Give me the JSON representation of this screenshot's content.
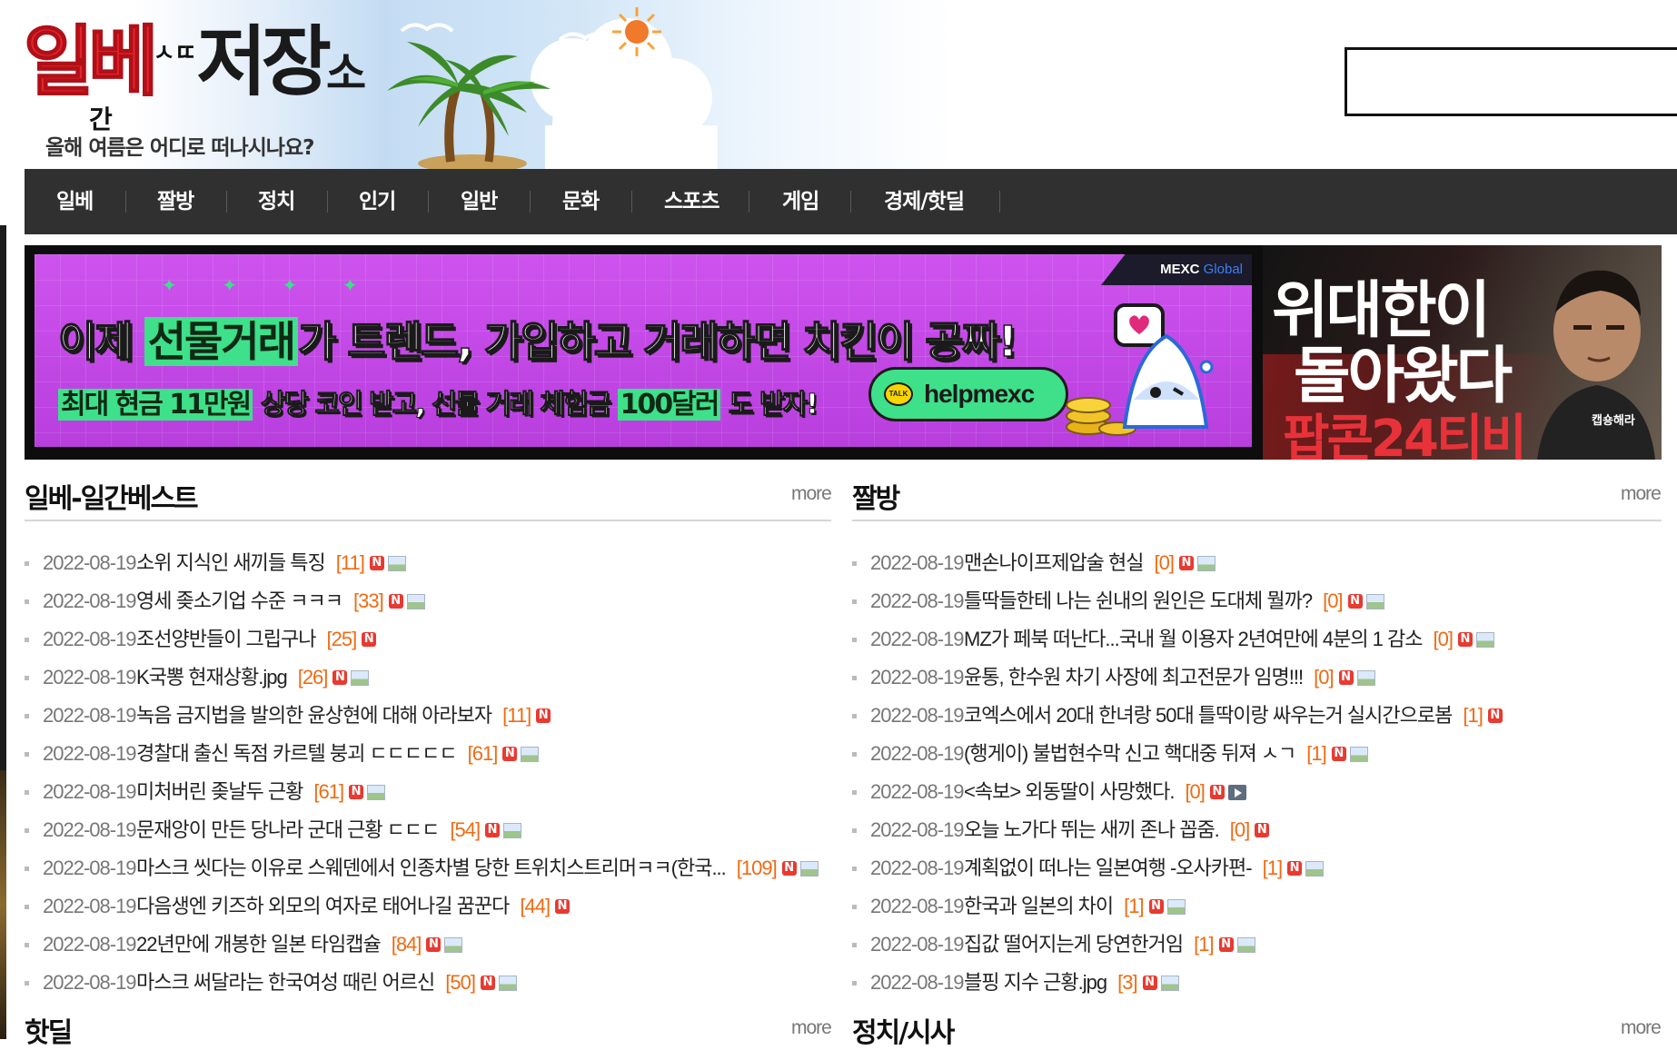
{
  "header": {
    "logo": {
      "main_red": "일베",
      "small_letters": "ㅅㄸ",
      "sub_char": "간",
      "main_black": "저장",
      "small_so": "소"
    },
    "tagline": "올해 여름은 어디로 떠나시나요?"
  },
  "nav": {
    "items": [
      "일베",
      "짤방",
      "정치",
      "인기",
      "일반",
      "문화",
      "스포츠",
      "게임",
      "경제/핫딜"
    ]
  },
  "ads": {
    "ad1": {
      "brand": "MEXC",
      "brand_suffix": "Global",
      "sparkles": "✦ ✦ ✦ ✦",
      "line1_pre": "이제 ",
      "line1_hl": "선물거래",
      "line1_post": "가 트렌드, 가입하고 거래하면 치킨이 공짜!",
      "line2_hl1": "최대 현금 11만원",
      "line2_mid": " 상당 코인 받고, 선물 거래 체험금 ",
      "line2_hl2": "100달러",
      "line2_post": " 도 받자!",
      "pill_icon": "TALK",
      "pill_text": "helpmexc"
    },
    "ad2": {
      "line1": "위대한이",
      "line2": "돌아왔다",
      "line3": "팝콘24티비",
      "tag": "캡숑해라"
    }
  },
  "boards": {
    "daily_best": {
      "title": "일베-일간베스트",
      "more": "more",
      "posts": [
        {
          "date": "2022-08-19",
          "title": "소위 지식인 새끼들 특징",
          "count": "[11]",
          "new": "N",
          "img": true,
          "vid": false
        },
        {
          "date": "2022-08-19",
          "title": "영세 좆소기업 수준 ㅋㅋㅋ",
          "count": "[33]",
          "new": "N",
          "img": true,
          "vid": false
        },
        {
          "date": "2022-08-19",
          "title": "조선양반들이 그립구나",
          "count": "[25]",
          "new": "N",
          "img": false,
          "vid": false
        },
        {
          "date": "2022-08-19",
          "title": "K국뽕 현재상황.jpg",
          "count": "[26]",
          "new": "N",
          "img": true,
          "vid": false
        },
        {
          "date": "2022-08-19",
          "title": "녹음 금지법을 발의한 윤상현에 대해 아라보자",
          "count": "[11]",
          "new": "N",
          "img": false,
          "vid": false
        },
        {
          "date": "2022-08-19",
          "title": "경찰대 출신 독점 카르텔 붕괴 ㄷㄷㄷㄷㄷ",
          "count": "[61]",
          "new": "N",
          "img": true,
          "vid": false
        },
        {
          "date": "2022-08-19",
          "title": "미처버린 좆날두 근황",
          "count": "[61]",
          "new": "N",
          "img": true,
          "vid": false
        },
        {
          "date": "2022-08-19",
          "title": "문재앙이 만든 당나라 군대 근황 ㄷㄷㄷ",
          "count": "[54]",
          "new": "N",
          "img": true,
          "vid": false
        },
        {
          "date": "2022-08-19",
          "title": "마스크 씻다는 이유로 스웨덴에서 인종차별 당한 트위치스트리머ㅋㅋ(한국...",
          "count": "[109]",
          "new": "N",
          "img": true,
          "vid": false
        },
        {
          "date": "2022-08-19",
          "title": "다음생엔 키즈하 외모의 여자로 태어나길 꿈꾼다",
          "count": "[44]",
          "new": "N",
          "img": false,
          "vid": false
        },
        {
          "date": "2022-08-19",
          "title": "22년만에 개봉한 일본 타임캡슐",
          "count": "[84]",
          "new": "N",
          "img": true,
          "vid": false
        },
        {
          "date": "2022-08-19",
          "title": "마스크 써달라는 한국여성 때린 어르신",
          "count": "[50]",
          "new": "N",
          "img": true,
          "vid": false
        }
      ]
    },
    "jjalbang": {
      "title": "짤방",
      "more": "more",
      "posts": [
        {
          "date": "2022-08-19",
          "title": "맨손나이프제압술 현실",
          "count": "[0]",
          "new": "N",
          "img": true,
          "vid": false
        },
        {
          "date": "2022-08-19",
          "title": "틀딱들한테 나는 쉰내의 원인은 도대체 뭘까?",
          "count": "[0]",
          "new": "N",
          "img": true,
          "vid": false
        },
        {
          "date": "2022-08-19",
          "title": "MZ가 페북 떠난다...국내 월 이용자 2년여만에 4분의 1 감소",
          "count": "[0]",
          "new": "N",
          "img": true,
          "vid": false
        },
        {
          "date": "2022-08-19",
          "title": "윤통, 한수원 차기 사장에 최고전문가 임명!!!",
          "count": "[0]",
          "new": "N",
          "img": true,
          "vid": false
        },
        {
          "date": "2022-08-19",
          "title": "코엑스에서 20대 한녀랑 50대 틀딱이랑 싸우는거 실시간으로봄",
          "count": "[1]",
          "new": "N",
          "img": false,
          "vid": false
        },
        {
          "date": "2022-08-19",
          "title": "(행게이) 불법현수막 신고 핵대중 뒤져 ㅅㄱ",
          "count": "[1]",
          "new": "N",
          "img": true,
          "vid": false
        },
        {
          "date": "2022-08-19",
          "title": "<속보> 외동딸이 사망했다.",
          "count": "[0]",
          "new": "N",
          "img": false,
          "vid": true
        },
        {
          "date": "2022-08-19",
          "title": "오늘 노가다 뛰는 새끼 존나 꼽줌.",
          "count": "[0]",
          "new": "N",
          "img": false,
          "vid": false
        },
        {
          "date": "2022-08-19",
          "title": "계획없이 떠나는 일본여행 -오사카편-",
          "count": "[1]",
          "new": "N",
          "img": true,
          "vid": false
        },
        {
          "date": "2022-08-19",
          "title": "한국과 일본의 차이",
          "count": "[1]",
          "new": "N",
          "img": true,
          "vid": false
        },
        {
          "date": "2022-08-19",
          "title": "집값 떨어지는게 당연한거임",
          "count": "[1]",
          "new": "N",
          "img": true,
          "vid": false
        },
        {
          "date": "2022-08-19",
          "title": "블핑 지수 근황.jpg",
          "count": "[3]",
          "new": "N",
          "img": true,
          "vid": false
        }
      ]
    },
    "hotdeal": {
      "title": "핫딜",
      "more": "more"
    },
    "politics": {
      "title": "정치/시사",
      "more": "more"
    }
  },
  "colors": {
    "nav_bg": "#303030",
    "count_orange": "#ef6b13",
    "new_badge_red": "#e73a30",
    "logo_red": "#e8232b",
    "ad_purple": "#c24ae6",
    "ad_green": "#3ee08a"
  },
  "icons": [
    "new-badge-icon",
    "image-attachment-icon",
    "video-attachment-icon",
    "palm-tree-icon",
    "sun-icon",
    "seagull-icon",
    "cloud-icon",
    "kakaotalk-icon",
    "mexc-logo-icon",
    "heart-chat-icon"
  ]
}
